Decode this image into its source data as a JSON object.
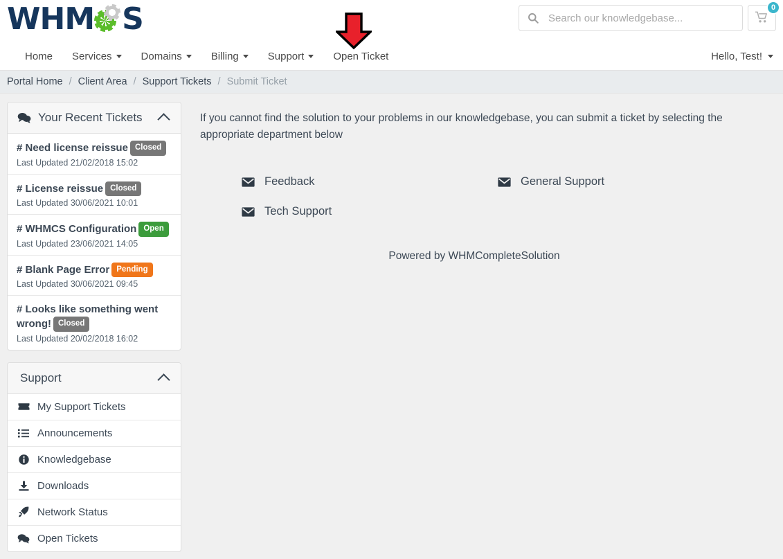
{
  "header": {
    "logo_text_left": "WHM",
    "logo_text_right": "S",
    "search": {
      "placeholder": "Search our knowledgebase...",
      "value": "",
      "icon": "search-icon"
    },
    "cart": {
      "icon": "shopping-cart-icon",
      "count": "0",
      "badge_color": "#3bb6cc"
    }
  },
  "nav": {
    "items": [
      {
        "label": "Home",
        "has_caret": false
      },
      {
        "label": "Services",
        "has_caret": true
      },
      {
        "label": "Domains",
        "has_caret": true
      },
      {
        "label": "Billing",
        "has_caret": true
      },
      {
        "label": "Support",
        "has_caret": true
      },
      {
        "label": "Open Ticket",
        "has_caret": false
      }
    ],
    "user_greeting": "Hello, Test!",
    "annotation": {
      "name": "red-down-arrow",
      "points_at": "Open Ticket",
      "color": "#e8212b"
    }
  },
  "breadcrumb": {
    "items": [
      {
        "label": "Portal Home",
        "active": false
      },
      {
        "label": "Client Area",
        "active": false
      },
      {
        "label": "Support Tickets",
        "active": false
      },
      {
        "label": "Submit Ticket",
        "active": true
      }
    ],
    "separator": "/"
  },
  "sidebar": {
    "recent_tickets": {
      "title": "Your Recent Tickets",
      "icon": "comments-icon",
      "collapse_icon": "chevron-up-icon",
      "items": [
        {
          "title": "# Need license reissue",
          "status": "Closed",
          "status_type": "closed",
          "meta": "Last Updated 21/02/2018 15:02"
        },
        {
          "title": "# License reissue",
          "status": "Closed",
          "status_type": "closed",
          "meta": "Last Updated 30/06/2021 10:01"
        },
        {
          "title": "# WHMCS Configuration",
          "status": "Open",
          "status_type": "open",
          "meta": "Last Updated 23/06/2021 14:05"
        },
        {
          "title": "# Blank Page Error",
          "status": "Pending",
          "status_type": "pending",
          "meta": "Last Updated 30/06/2021 09:45"
        },
        {
          "title": "# Looks like something went wrong!",
          "status": "Closed",
          "status_type": "closed",
          "meta": "Last Updated 20/02/2018 16:02"
        }
      ]
    },
    "support": {
      "title": "Support",
      "collapse_icon": "chevron-up-icon",
      "items": [
        {
          "label": "My Support Tickets",
          "icon": "ticket-icon"
        },
        {
          "label": "Announcements",
          "icon": "list-icon"
        },
        {
          "label": "Knowledgebase",
          "icon": "info-circle-icon"
        },
        {
          "label": "Downloads",
          "icon": "download-icon"
        },
        {
          "label": "Network Status",
          "icon": "rocket-icon"
        },
        {
          "label": "Open Tickets",
          "icon": "comments-icon"
        }
      ]
    }
  },
  "main": {
    "intro": "If you cannot find the solution to your problems in our knowledgebase, you can submit a ticket by selecting the appropriate department below",
    "departments": [
      {
        "label": "Feedback",
        "icon": "envelope-icon"
      },
      {
        "label": "General Support",
        "icon": "envelope-icon"
      },
      {
        "label": "Tech Support",
        "icon": "envelope-icon"
      }
    ],
    "powered_by": "Powered by WHMCompleteSolution"
  },
  "colors": {
    "brand_navy": "#16365c",
    "brand_green": "#5bbd2a",
    "page_bg": "#f0f0f0",
    "breadcrumb_bg": "#e9ecee"
  }
}
